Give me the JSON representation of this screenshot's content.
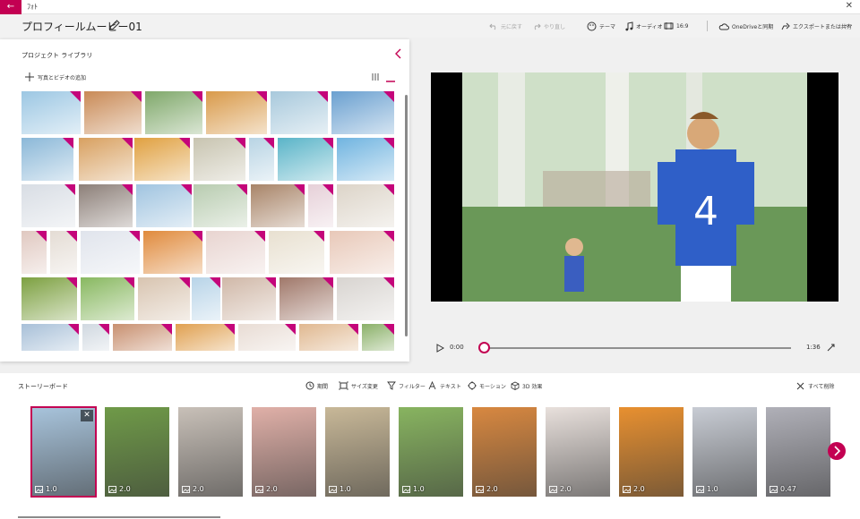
{
  "app": {
    "back_icon": "back-arrow-icon",
    "title": "ﾌｫﾄ",
    "close_icon": "close-icon"
  },
  "toolbar": {
    "project_title": "プロフィールムービー01",
    "undo": "元に戻す",
    "redo": "やり直し",
    "theme": "テーマ",
    "audio": "オーディオ",
    "aspect": "16:9",
    "onedrive": "OneDriveと同期",
    "export": "エクスポートまたは共有",
    "more": "..."
  },
  "library": {
    "title": "プロジェクト ライブラリ",
    "add_label": "写真とビデオの追加",
    "thumbs": [
      "#9cc7e3",
      "#c98a56",
      "#7fa86a",
      "#d99a4a",
      "#a8c9dc",
      "#6aa0d0",
      "#8bb8d8",
      "#d8a060",
      "#e0a040",
      "#c8c4b0",
      "#b8d4e4",
      "#5ab4c8",
      "#70b4e0",
      "#d8dde4",
      "#8c7f78",
      "#a0c4e0",
      "#b8ccb0",
      "#a88468",
      "#e6d0d8",
      "#dcd4c8",
      "#e0c8c0",
      "#e4dcd4",
      "#e0e4ec",
      "#e08a3c",
      "#e8d4d0",
      "#e8e0d0",
      "#e8c8b8",
      "#7ca040",
      "#88b860",
      "#d8c4b0",
      "#b8d4e8",
      "#d0b8a8",
      "#a0786a",
      "#d8d4d0",
      "#a8c0d8",
      "#d0d8e0",
      "#c89070",
      "#e0a050",
      "#e8dcd4",
      "#e0b890",
      "#8ab068",
      "#d0e0ec"
    ]
  },
  "preview": {
    "play_icon": "play-icon",
    "current_time": "0:00",
    "total_time": "1:36",
    "progress": 0.0,
    "fullscreen_icon": "fullscreen-icon"
  },
  "storyboard": {
    "title": "ストーリーボード",
    "tools": {
      "duration": "期間",
      "resize": "サイズ変更",
      "filters": "フィルター",
      "text": "テキスト",
      "motion": "モーション",
      "effects": "3D 効果"
    },
    "delete_all": "すべて削除",
    "cards": [
      {
        "duration": "1.0",
        "color": "#a8c4dc",
        "selected": true
      },
      {
        "duration": "2.0",
        "color": "#6f9a48",
        "selected": false
      },
      {
        "duration": "2.0",
        "color": "#c8c0b8",
        "selected": false
      },
      {
        "duration": "2.0",
        "color": "#e0b0a8",
        "selected": false
      },
      {
        "duration": "1.0",
        "color": "#c8b898",
        "selected": false
      },
      {
        "duration": "1.0",
        "color": "#88b460",
        "selected": false
      },
      {
        "duration": "2.0",
        "color": "#d88840",
        "selected": false
      },
      {
        "duration": "2.0",
        "color": "#e8e0dc",
        "selected": false
      },
      {
        "duration": "2.0",
        "color": "#e89030",
        "selected": false
      },
      {
        "duration": "1.0",
        "color": "#c8ccd4",
        "selected": false
      },
      {
        "duration": "0.47",
        "color": "#b0b0b8",
        "selected": false
      }
    ]
  },
  "colors": {
    "accent": "#c30052",
    "thumb_flag": "#c4057a"
  }
}
